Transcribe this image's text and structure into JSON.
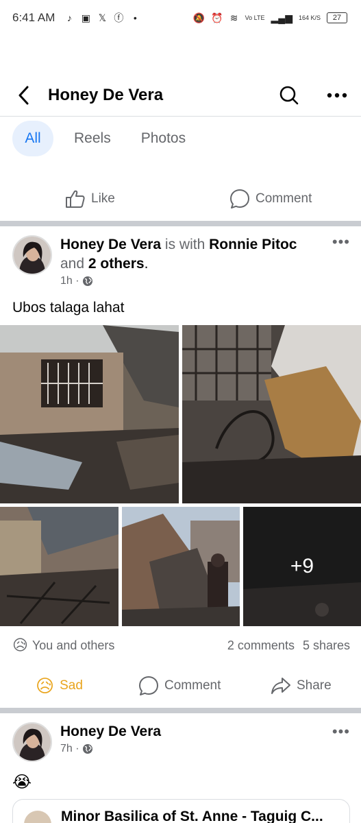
{
  "status_bar": {
    "time": "6:41 AM",
    "icons": [
      "tiktok-icon",
      "app-icon",
      "x-icon",
      "facebook-icon",
      "dot-icon"
    ],
    "network": "Vo LTE",
    "speed": "164 K/S",
    "battery": "27"
  },
  "header": {
    "title": "Honey De Vera"
  },
  "tabs": [
    {
      "label": "All"
    },
    {
      "label": "Reels"
    },
    {
      "label": "Photos"
    }
  ],
  "top_actions": {
    "like": "Like",
    "comment": "Comment"
  },
  "post1": {
    "author": "Honey De Vera",
    "with_text": "is with",
    "tagged": "Ronnie Pitoc",
    "and_text": "and",
    "others": "2 others",
    "period": ".",
    "time": "1h ·",
    "text": "Ubos talaga lahat",
    "more_photos": "+9",
    "reactions_text": "You and others",
    "comments": "2 comments",
    "shares": "5 shares",
    "actions": {
      "sad": "Sad",
      "comment": "Comment",
      "share": "Share"
    }
  },
  "post2": {
    "author": "Honey De Vera",
    "time": "7h ·",
    "emoji": "😭",
    "link_title": "Minor Basilica of St. Anne - Taguig C..."
  },
  "colors": {
    "accent": "#1877f2",
    "secondary_text": "#65676b",
    "sad": "#e9a41c"
  }
}
